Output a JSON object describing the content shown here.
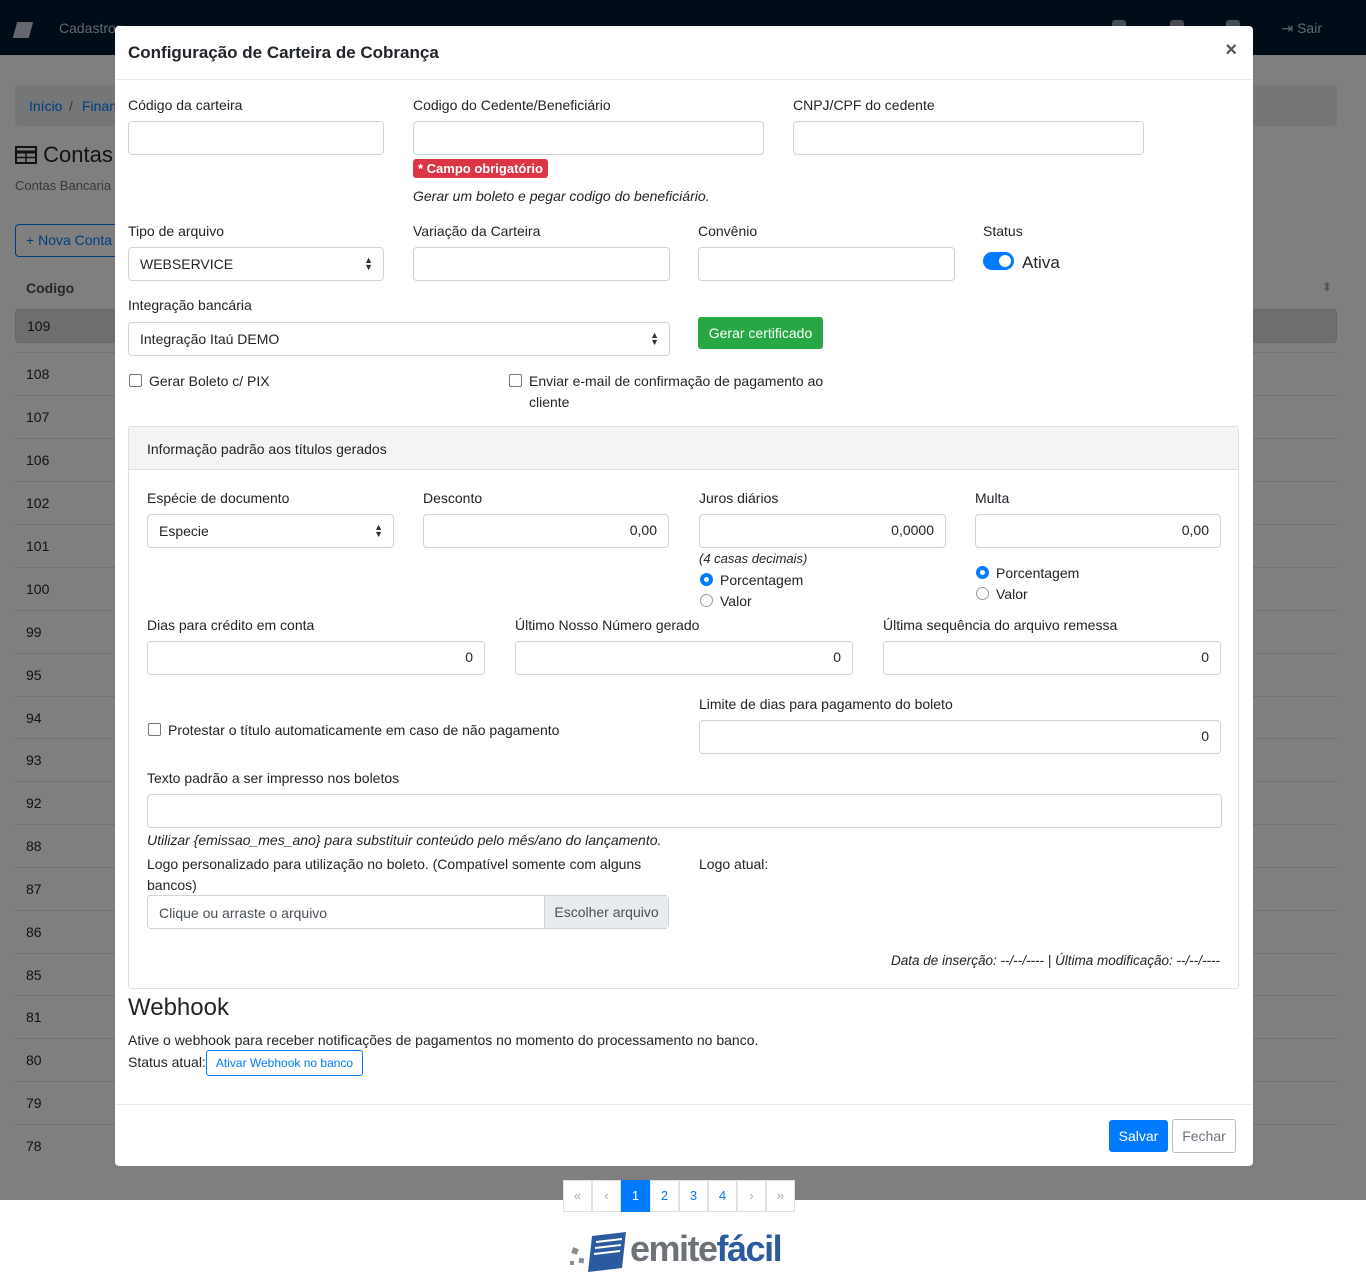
{
  "topnav": {
    "items": [
      "Cadastros",
      "Sair"
    ]
  },
  "breadcrumb": {
    "items": [
      "Início",
      "/",
      "Finan"
    ]
  },
  "page": {
    "title": "Contas",
    "subtitle": "Contas Bancaria",
    "new_button": "Nova Conta",
    "col_header": "Codigo"
  },
  "rows": [
    "109",
    "108",
    "107",
    "106",
    "102",
    "101",
    "100",
    "99",
    "95",
    "94",
    "93",
    "92",
    "88",
    "87",
    "86",
    "85",
    "81",
    "80",
    "79",
    "78"
  ],
  "pagination": [
    "«",
    "‹",
    "1",
    "2",
    "3",
    "4",
    "›",
    "»"
  ],
  "modal": {
    "title": "Configuração de Carteira de Cobrança",
    "close": "×",
    "fields": {
      "codigo_carteira": {
        "label": "Código da carteira",
        "value": ""
      },
      "codigo_cedente": {
        "label": "Codigo do Cedente/Beneficiário",
        "value": "",
        "required_badge": "* Campo obrigatório",
        "hint": "Gerar um boleto e pegar codigo do beneficiário."
      },
      "cnpj_cedente": {
        "label": "CNPJ/CPF do cedente",
        "value": ""
      },
      "tipo_arquivo": {
        "label": "Tipo de arquivo",
        "value": "WEBSERVICE"
      },
      "variacao": {
        "label": "Variação da Carteira",
        "value": ""
      },
      "convenio": {
        "label": "Convênio",
        "value": ""
      },
      "status": {
        "label": "Status",
        "value": "Ativa",
        "on": true
      },
      "integracao": {
        "label": "Integração bancária",
        "value": "Integração Itaú DEMO"
      },
      "gerar_certificado": "Gerar certificado",
      "gerar_pix": {
        "label": "Gerar Boleto c/ PIX",
        "checked": false
      },
      "enviar_email": {
        "label_line1": "Enviar e-mail de confirmação de pagamento ao",
        "label_line2": "cliente",
        "checked": false
      }
    },
    "card": {
      "title": "Informação padrão aos títulos gerados",
      "especie": {
        "label": "Espécie de documento",
        "value": "Especie"
      },
      "desconto": {
        "label": "Desconto",
        "value": "0,00"
      },
      "juros": {
        "label": "Juros diários",
        "value": "0,0000",
        "hint": "(4 casas decimais)",
        "opt1": "Porcentagem",
        "opt2": "Valor",
        "selected": "Porcentagem"
      },
      "multa": {
        "label": "Multa",
        "value": "0,00",
        "opt1": "Porcentagem",
        "opt2": "Valor",
        "selected": "Porcentagem"
      },
      "dias_credito": {
        "label": "Dias para crédito em conta",
        "value": "0"
      },
      "ultimo_nosso_numero": {
        "label": "Último Nosso Número gerado",
        "value": "0"
      },
      "ultima_sequencia": {
        "label": "Última sequência do arquivo remessa",
        "value": "0"
      },
      "protestar": {
        "label": "Protestar o título automaticamente em caso de não pagamento",
        "checked": false
      },
      "limite_dias": {
        "label": "Limite de dias para pagamento do boleto",
        "value": "0"
      },
      "texto_padrao": {
        "label": "Texto padrão a ser impresso nos boletos",
        "value": "",
        "hint": "Utilizar {emissao_mes_ano} para substituir conteúdo pelo mês/ano do lançamento."
      },
      "logo": {
        "label_line1": "Logo personalizado para utilização no boleto. (Compatível somente com alguns",
        "label_line2": "bancos)",
        "placeholder": "Clique ou arraste o arquivo",
        "button": "Escolher arquivo",
        "current_label": "Logo atual:"
      },
      "meta": "Data de inserção: --/--/---- | Última modificação: --/--/----"
    },
    "webhook": {
      "title": "Webhook",
      "description": "Ative o webhook para receber notificações de pagamentos no momento do processamento no banco.",
      "status_label": "Status atual:",
      "button": "Ativar Webhook no banco"
    },
    "footer": {
      "save": "Salvar",
      "close": "Fechar"
    }
  },
  "brand": {
    "name_part1": "emite",
    "name_part2": "fácil"
  },
  "colors": {
    "primary": "#007bff",
    "success": "#28a745",
    "danger": "#dc3545",
    "navbar": "#001a33"
  }
}
